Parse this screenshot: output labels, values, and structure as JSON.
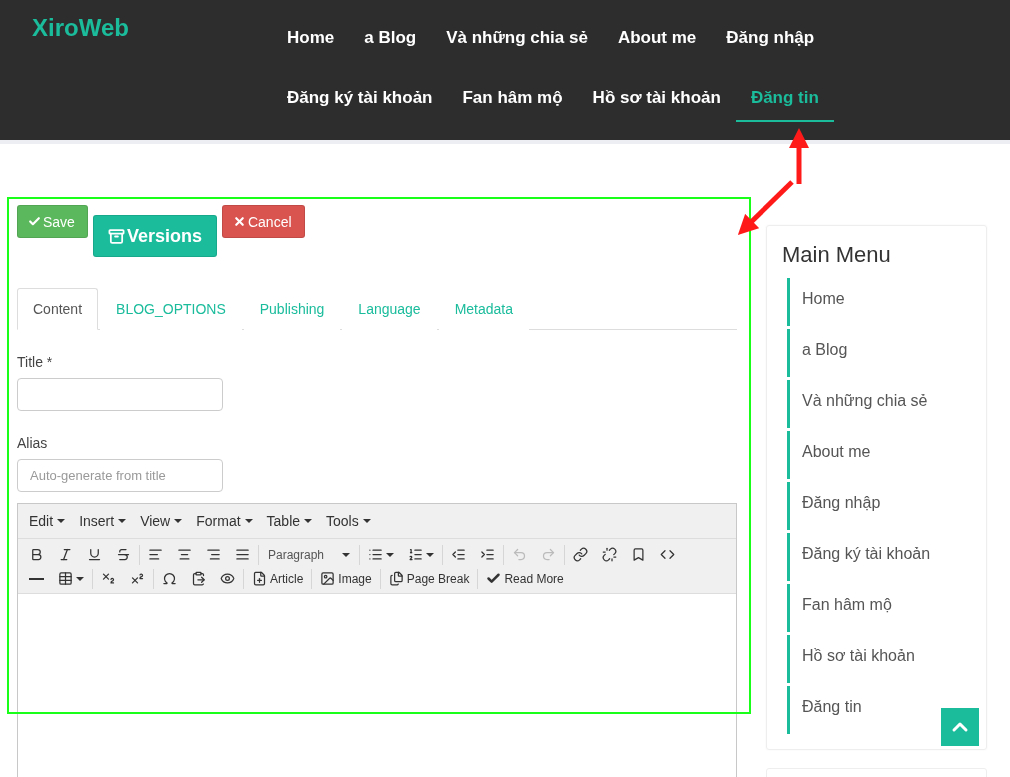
{
  "header": {
    "logo": "XiroWeb",
    "nav_rows": [
      [
        {
          "label": "Home",
          "selected": false
        },
        {
          "label": "a Blog",
          "selected": false
        },
        {
          "label": "Và những chia sẻ",
          "selected": false
        },
        {
          "label": "About me",
          "selected": false
        },
        {
          "label": "Đăng nhập",
          "selected": false
        }
      ],
      [
        {
          "label": "Đăng ký tài khoản",
          "selected": false
        },
        {
          "label": "Fan hâm mộ",
          "selected": false
        },
        {
          "label": "Hồ sơ tài khoản",
          "selected": false
        },
        {
          "label": "Đăng tin",
          "selected": true
        }
      ]
    ]
  },
  "actions": {
    "save": "Save",
    "versions": "Versions",
    "cancel": "Cancel"
  },
  "tabs": [
    {
      "label": "Content",
      "selected": true
    },
    {
      "label": "BLOG_OPTIONS",
      "selected": false
    },
    {
      "label": "Publishing",
      "selected": false
    },
    {
      "label": "Language",
      "selected": false
    },
    {
      "label": "Metadata",
      "selected": false
    }
  ],
  "form": {
    "title_label": "Title *",
    "alias_label": "Alias",
    "alias_placeholder": "Auto-generate from title"
  },
  "editor": {
    "menus": [
      "Edit",
      "Insert",
      "View",
      "Format",
      "Table",
      "Tools"
    ],
    "block_format": "Paragraph",
    "undo_disabled": true,
    "redo_disabled": true,
    "article": "Article",
    "image": "Image",
    "page_break": "Page Break",
    "read_more": "Read More"
  },
  "sidebar": {
    "title": "Main Menu",
    "items": [
      "Home",
      "a Blog",
      "Và những chia sẻ",
      "About me",
      "Đăng nhập",
      "Đăng ký tài khoản",
      "Fan hâm mộ",
      "Hồ sơ tài khoản",
      "Đăng tin"
    ]
  }
}
